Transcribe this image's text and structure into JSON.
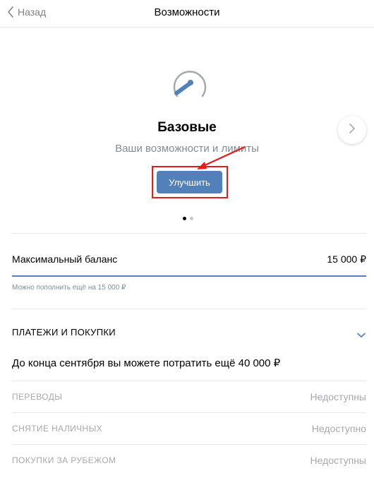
{
  "header": {
    "back_label": "Назад",
    "title": "Возможности"
  },
  "level": {
    "title": "Базовые",
    "subtitle": "Ваши возможности и лимиты",
    "upgrade_label": "Улучшить"
  },
  "icons": {
    "back": "chevron-left-icon",
    "gauge": "speedometer-icon",
    "next": "chevron-right-icon",
    "section_toggle": "chevron-down-icon"
  },
  "colors": {
    "accent": "#5181b8",
    "highlight": "#e41b1b",
    "muted": "#818c99"
  },
  "carousel": {
    "pages": 2,
    "active_page": 1
  },
  "balance": {
    "label": "Максимальный баланс",
    "value": "15 000 ₽",
    "hint": "Можно пополнить ещё на 15 000 ₽"
  },
  "payments": {
    "title": "ПЛАТЕЖИ И ПОКУПКИ",
    "description": "До конца сентября вы можете потратить ещё 40 000 ₽",
    "limits": [
      {
        "name": "ПЕРЕВОДЫ",
        "status": "Недоступны"
      },
      {
        "name": "СНЯТИЕ НАЛИЧНЫХ",
        "status": "Недоступно"
      },
      {
        "name": "ПОКУПКИ ЗА РУБЕЖОМ",
        "status": "Недоступны"
      }
    ]
  }
}
